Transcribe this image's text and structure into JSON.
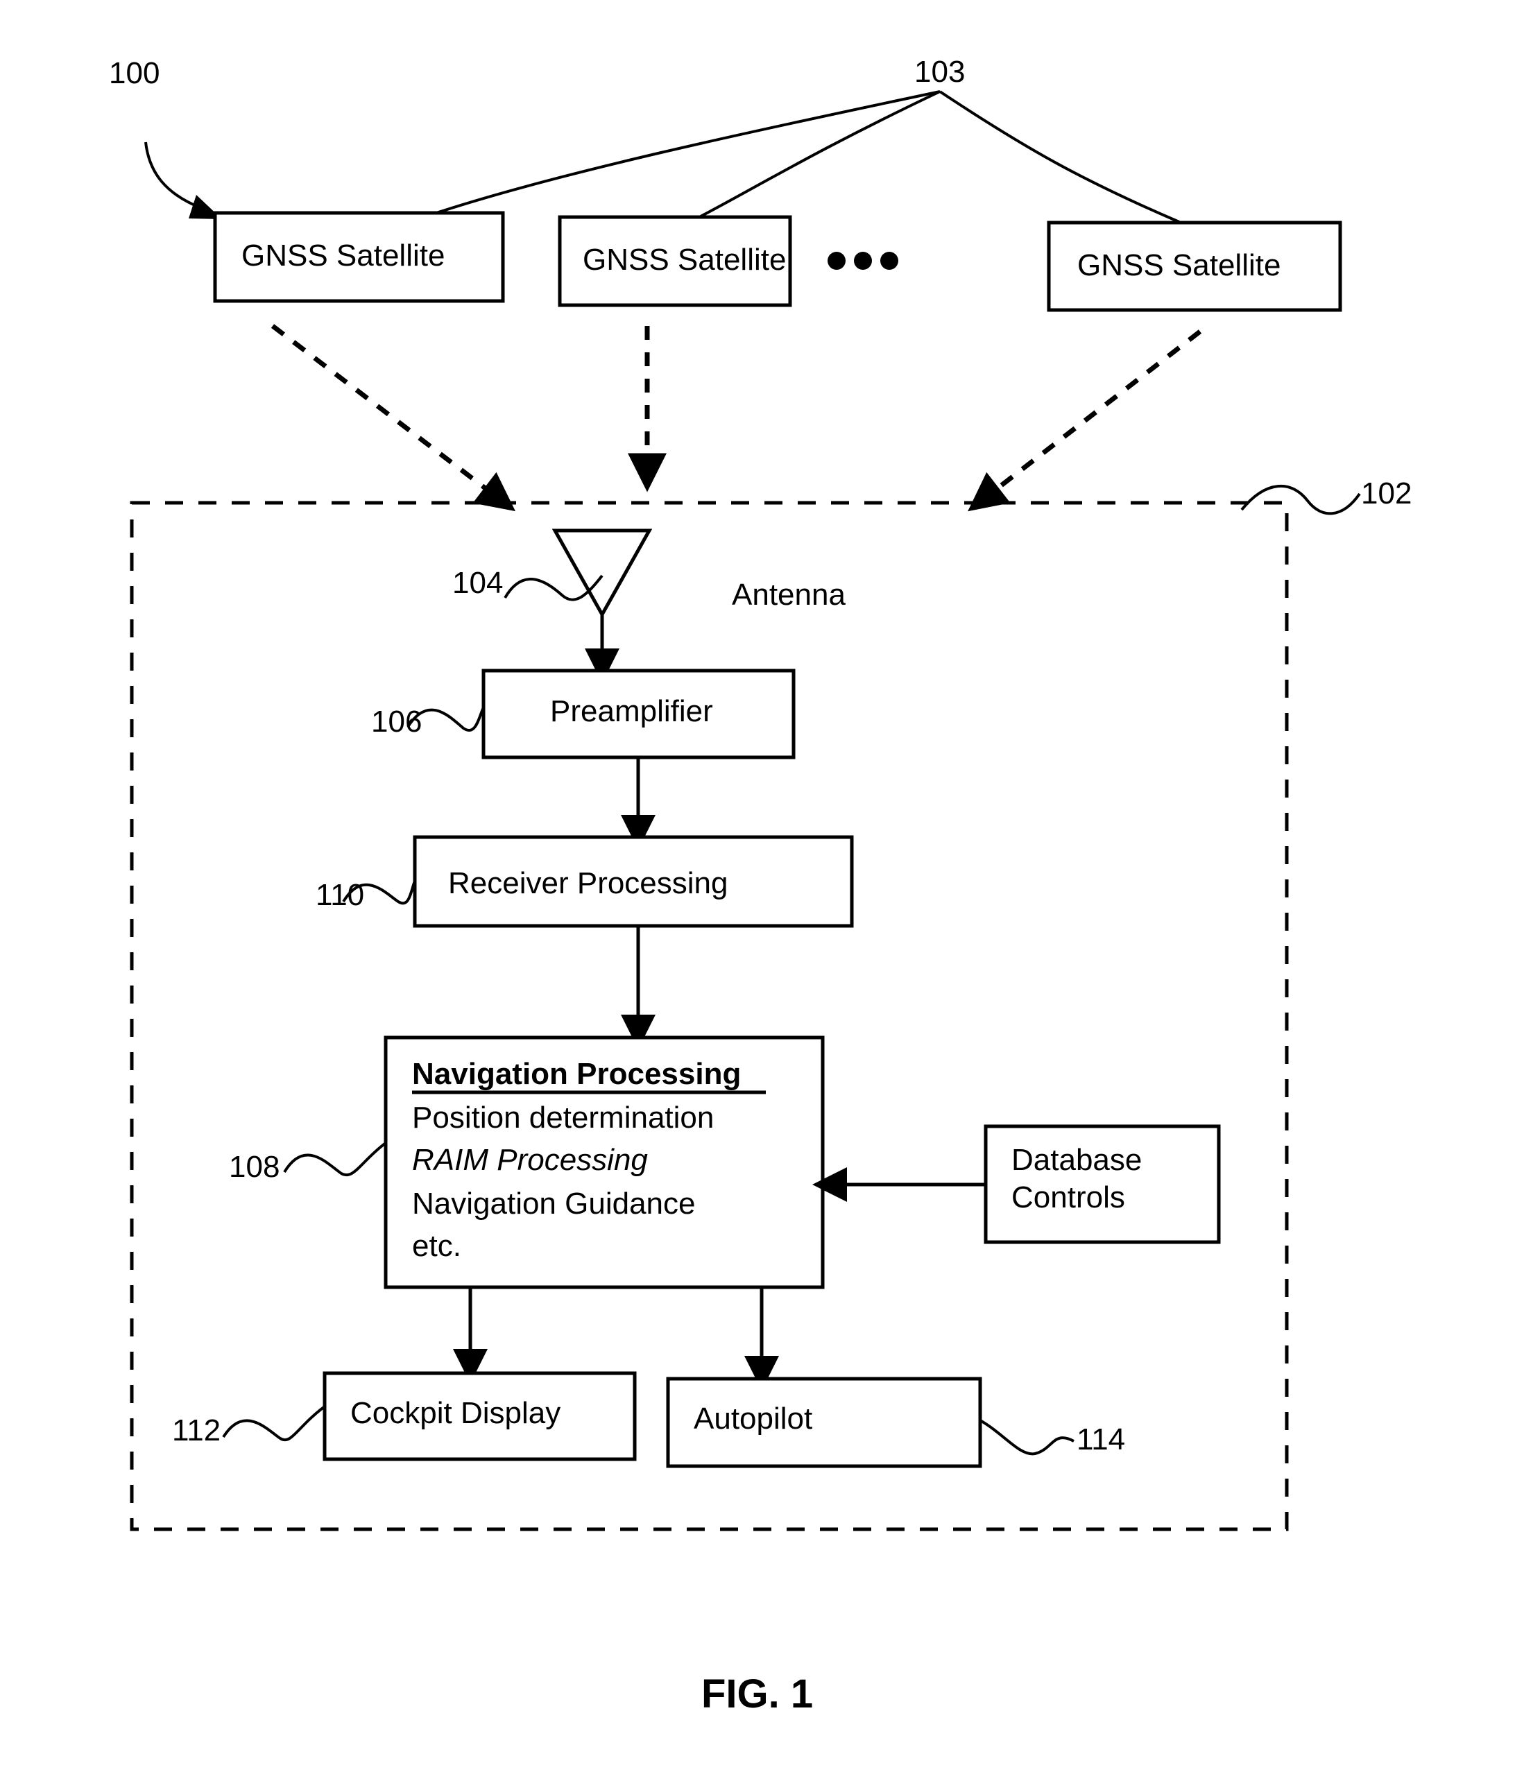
{
  "figure": {
    "caption": "FIG. 1",
    "system_ref": "100",
    "constellation_ref": "103",
    "receiver_ref": "102"
  },
  "satellites": [
    {
      "label": "GNSS Satellite"
    },
    {
      "label": "GNSS Satellite"
    },
    {
      "label": "GNSS Satellite"
    }
  ],
  "ellipsis": "•  •  •",
  "antenna": {
    "ref": "104",
    "label": "Antenna"
  },
  "blocks": {
    "preamplifier": {
      "ref": "106",
      "label": "Preamplifier"
    },
    "receiver_processing": {
      "ref": "110",
      "label": "Receiver Processing"
    },
    "navigation_processing": {
      "ref": "108",
      "title": "Navigation Processing",
      "lines": [
        "Position determination",
        "RAIM Processing",
        "Navigation Guidance",
        "etc."
      ]
    },
    "database_controls": {
      "line1": "Database",
      "line2": "Controls"
    },
    "cockpit_display": {
      "ref": "112",
      "label": "Cockpit Display"
    },
    "autopilot": {
      "ref": "114",
      "label": "Autopilot"
    }
  }
}
